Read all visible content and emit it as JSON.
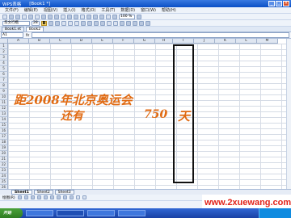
{
  "window": {
    "title": "WPS表格",
    "tab_label": "[Book1 *]",
    "buttons": [
      "_",
      "□",
      "×"
    ]
  },
  "menubar": {
    "items": [
      "文件(F)",
      "编辑(E)",
      "视图(V)",
      "插入(I)",
      "格式(O)",
      "工具(T)",
      "数据(D)",
      "窗口(W)",
      "帮助(H)"
    ]
  },
  "toolbar": {
    "zoom": "100 %",
    "font": "华文行楷",
    "size": "28",
    "bold": "B"
  },
  "doctabs": [
    "Book1.et",
    "Book2"
  ],
  "formula": {
    "namebox": "A1",
    "fx": "fx"
  },
  "columns": [
    "A",
    "B",
    "C",
    "D",
    "E",
    "F",
    "G",
    "H",
    "I",
    "J",
    "K",
    "L",
    "M"
  ],
  "rows": [
    "1",
    "2",
    "3",
    "4",
    "5",
    "6",
    "7",
    "8",
    "9",
    "10",
    "11",
    "12",
    "13",
    "14",
    "15",
    "16",
    "17",
    "18",
    "19",
    "20",
    "21",
    "22",
    "23",
    "24",
    "25",
    "26"
  ],
  "cells": {
    "line1": "距2008年北京奥运会",
    "line2": "还有",
    "number": "750",
    "unit": "天"
  },
  "sheets": [
    "Sheet1",
    "Sheet2",
    "Sheet3"
  ],
  "drawbar": {
    "label": "绘图(R)"
  },
  "watermark": "www.2xuewang.com",
  "taskbar": {
    "start": "开始"
  }
}
